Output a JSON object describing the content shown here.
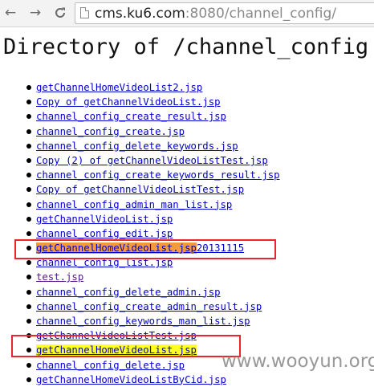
{
  "browser": {
    "back_label": "←",
    "forward_label": "→",
    "reload_label": "C",
    "url_host": "cms.ku6.com",
    "url_rest": ":8080/channel_config/"
  },
  "page": {
    "title": "Directory of /channel_config",
    "files": [
      {
        "name": "getChannelHomeVideoList2.jsp"
      },
      {
        "name": "Copy of getChannelVideoList.jsp"
      },
      {
        "name": "channel_config_create_result.jsp"
      },
      {
        "name": "channel_config_create.jsp"
      },
      {
        "name": "channel_config_delete_keywords.jsp"
      },
      {
        "name": "Copy (2) of getChannelVideoListTest.jsp"
      },
      {
        "name": "channel_config_create_keywords_result.jsp"
      },
      {
        "name": "Copy of getChannelVideoListTest.jsp"
      },
      {
        "name": "channel_config_admin_man_list.jsp"
      },
      {
        "name": "getChannelVideoList.jsp"
      },
      {
        "name": "channel_config_edit.jsp"
      },
      {
        "name": "getChannelHomeVideoList.jsp",
        "suffix": "20131115",
        "highlight": "#f59a3c"
      },
      {
        "name": "channel_config_list.jsp"
      },
      {
        "name": "test.jsp",
        "visited": true
      },
      {
        "name": "channel_config_delete_admin.jsp"
      },
      {
        "name": "channel_config_create_admin_result.jsp"
      },
      {
        "name": "channel_config_keywords_man_list.jsp"
      },
      {
        "name": "getChannelVideoListTest.jsp"
      },
      {
        "name": "getChannelHomeVideoList.jsp",
        "highlight": "#ffff2a"
      },
      {
        "name": "channel_config_delete.jsp"
      },
      {
        "name": "getChannelHomeVideoListByCid.jsp"
      }
    ]
  },
  "annotations": {
    "box_color": "#e8262c"
  },
  "watermark": "www.wooyun.org"
}
